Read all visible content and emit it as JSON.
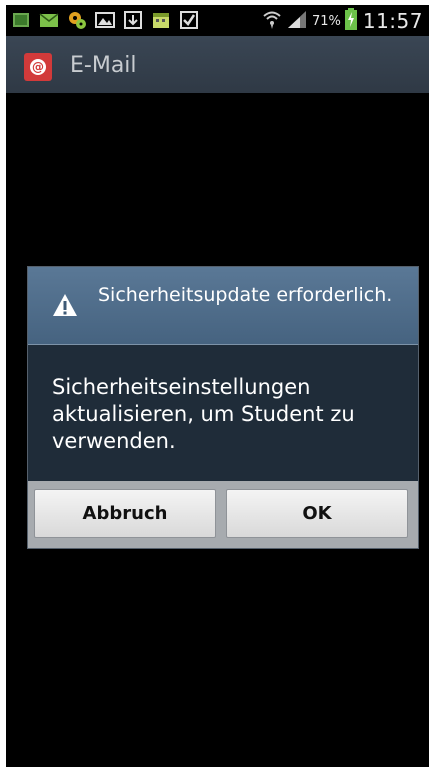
{
  "status_bar": {
    "notification_icons": [
      "photo-notification-icon",
      "email-notification-icon",
      "settings-notification-icon",
      "gallery-notification-icon",
      "download-notification-icon",
      "calendar-notification-icon",
      "task-check-notification-icon"
    ],
    "battery_percent": "71%",
    "time": "11:57"
  },
  "app_bar": {
    "title": "E-Mail",
    "icon": "email-app-icon"
  },
  "dialog": {
    "icon": "warning-icon",
    "title": "Sicherheitsupdate erforderlich.",
    "message": "Sicherheitseinstellungen aktualisieren, um Student zu verwenden.",
    "buttons": {
      "cancel": "Abbruch",
      "ok": "OK"
    }
  },
  "colors": {
    "dialog_header": "#4f6d8a",
    "dialog_body": "#1f2c39",
    "action_bar": "#344050",
    "app_icon": "#d23a3a",
    "battery_charging": "#6cc24a"
  }
}
